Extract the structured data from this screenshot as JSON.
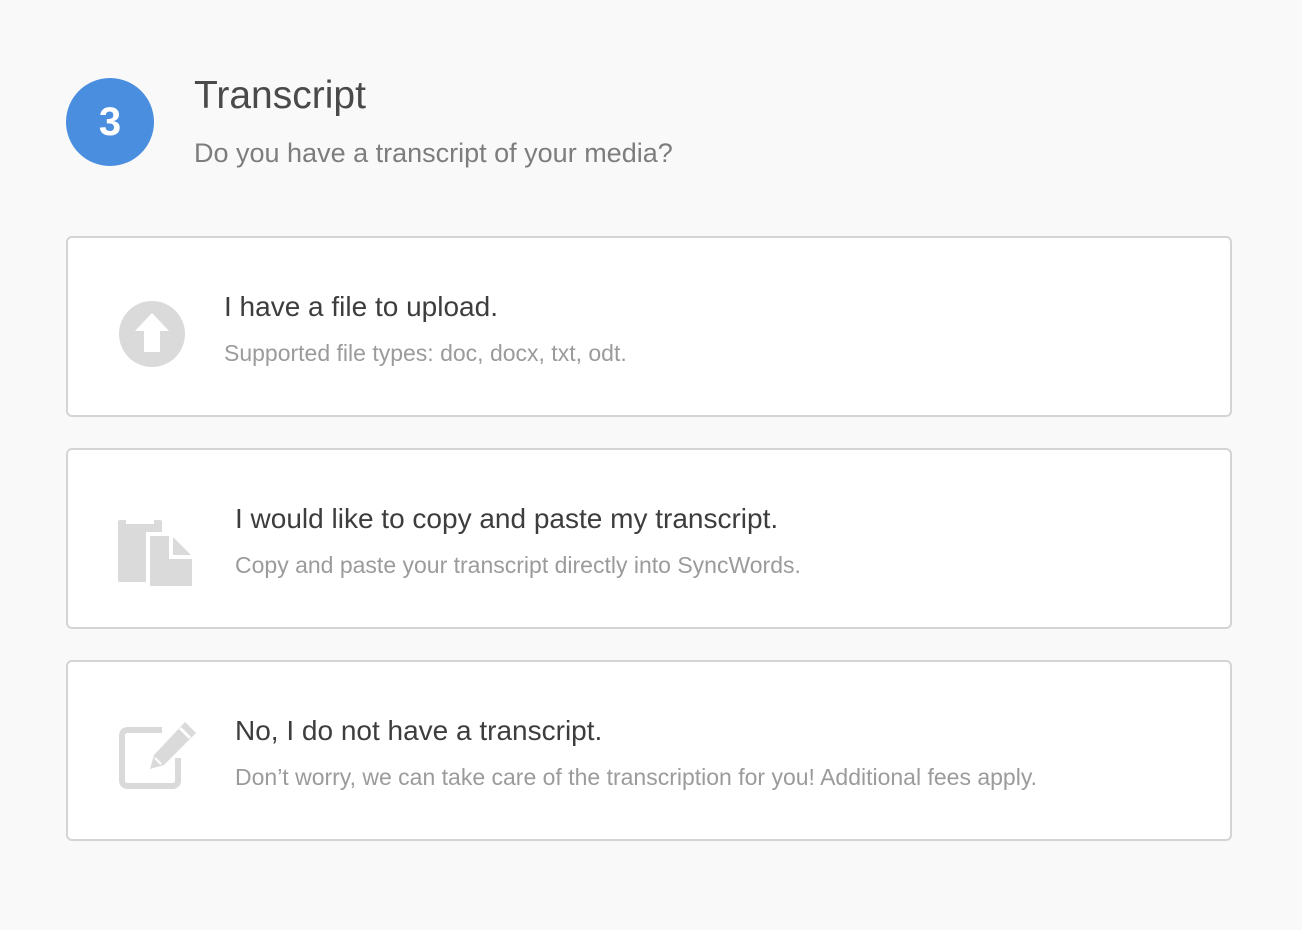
{
  "step": {
    "number": "3",
    "title": "Transcript",
    "subtitle": "Do you have a transcript of your media?",
    "badge_color": "#4a8ee0"
  },
  "options": [
    {
      "icon": "upload-arrow-icon",
      "title": "I have a file to upload.",
      "description": "Supported file types: doc, docx, txt, odt."
    },
    {
      "icon": "copy-paste-documents-icon",
      "title": "I would like to copy and paste my transcript.",
      "description": "Copy and paste your transcript directly into SyncWords."
    },
    {
      "icon": "edit-pencil-icon",
      "title": "No, I do not have a transcript.",
      "description": "Don’t worry, we can take care of the transcription for you! Additional fees apply."
    }
  ],
  "colors": {
    "background": "#f9f9f9",
    "card_border": "#d4d4d4",
    "icon_gray": "#dadada",
    "title_text": "#3d3d3d",
    "muted_text": "#9b9b9b"
  }
}
